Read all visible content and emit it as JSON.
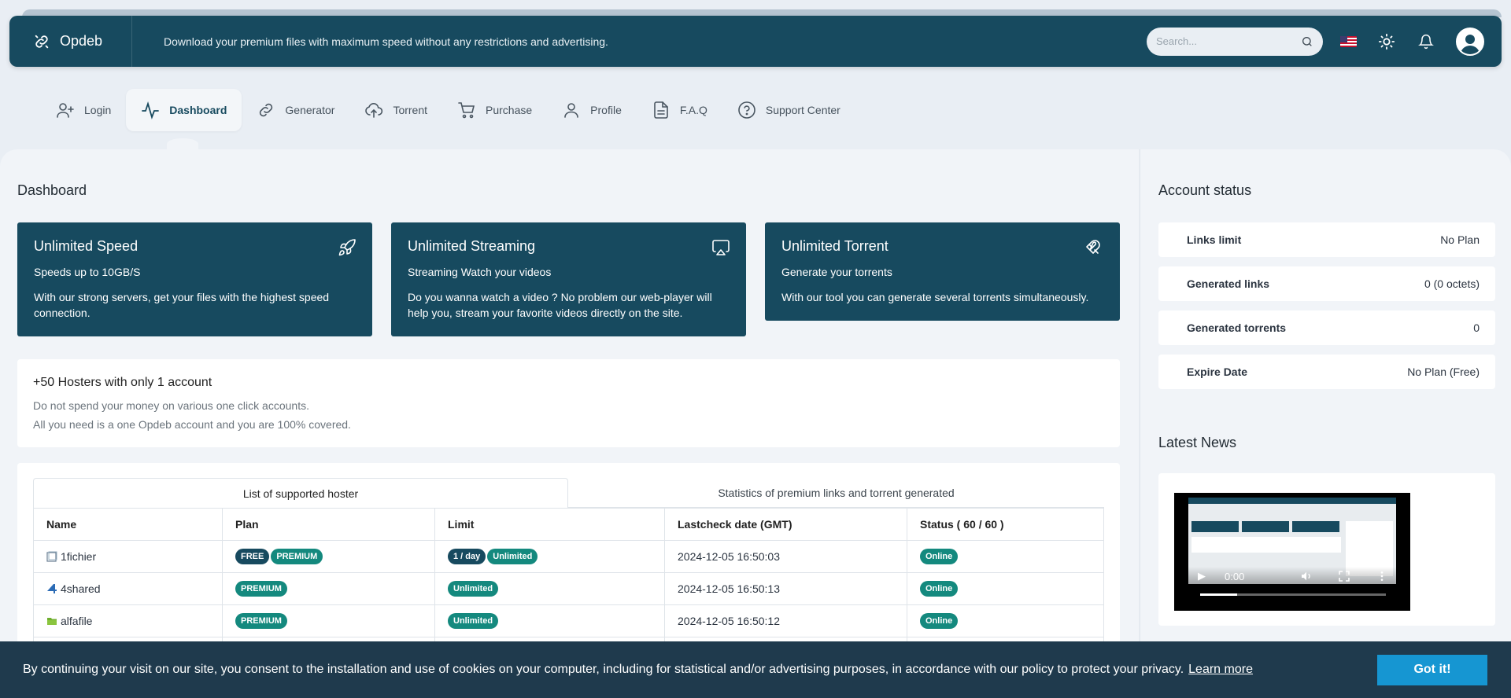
{
  "header": {
    "brand": "Opdeb",
    "tagline": "Download your premium files with maximum speed without any restrictions and advertising.",
    "search_placeholder": "Search..."
  },
  "nav": {
    "items": [
      {
        "label": "Login",
        "icon": "user-plus-icon"
      },
      {
        "label": "Dashboard",
        "icon": "activity-icon",
        "active": true
      },
      {
        "label": "Generator",
        "icon": "link-icon"
      },
      {
        "label": "Torrent",
        "icon": "cloud-upload-icon"
      },
      {
        "label": "Purchase",
        "icon": "cart-icon"
      },
      {
        "label": "Profile",
        "icon": "user-icon"
      },
      {
        "label": "F.A.Q",
        "icon": "file-icon"
      },
      {
        "label": "Support Center",
        "icon": "help-circle-icon"
      }
    ]
  },
  "dashboard": {
    "title": "Dashboard",
    "features": [
      {
        "title": "Unlimited Speed",
        "sub": "Speeds up to 10GB/S",
        "desc": "With our strong servers, get your files with the highest speed connection.",
        "icon": "rocket-icon"
      },
      {
        "title": "Unlimited Streaming",
        "sub": "Streaming Watch your videos",
        "desc": "Do you wanna watch a video ? No problem our web-player will help you, stream your favorite videos directly on the site.",
        "icon": "airplay-icon"
      },
      {
        "title": "Unlimited Torrent",
        "sub": "Generate your torrents",
        "desc": "With our tool you can generate several torrents simultaneously.",
        "icon": "magnet-icon"
      }
    ],
    "hosters": {
      "title": "+50 Hosters with only 1 account",
      "line1": "Do not spend your money on various one click accounts.",
      "line2": "All you need is a one Opdeb account and you are 100% covered."
    },
    "tabs": [
      "List of supported hoster",
      "Statistics of premium links and torrent generated"
    ],
    "table": {
      "headers": [
        "Name",
        "Plan",
        "Limit",
        "Lastcheck date (GMT)",
        "Status ( 60 / 60 )"
      ],
      "rows": [
        {
          "name": "1fichier",
          "plan": [
            "FREE",
            "PREMIUM"
          ],
          "limit": [
            "1 / day",
            "Unlimited"
          ],
          "date": "2024-12-05 16:50:03",
          "status": "Online"
        },
        {
          "name": "4shared",
          "plan": [
            "PREMIUM"
          ],
          "limit": [
            "Unlimited"
          ],
          "date": "2024-12-05 16:50:13",
          "status": "Online"
        },
        {
          "name": "alfafile",
          "plan": [
            "PREMIUM"
          ],
          "limit": [
            "Unlimited"
          ],
          "date": "2024-12-05 16:50:12",
          "status": "Online"
        }
      ]
    }
  },
  "account": {
    "title": "Account status",
    "items": [
      {
        "label": "Links limit",
        "value": "No Plan"
      },
      {
        "label": "Generated links",
        "value": "0 (0 octets)"
      },
      {
        "label": "Generated torrents",
        "value": "0"
      },
      {
        "label": "Expire Date",
        "value": "No Plan (Free)"
      }
    ]
  },
  "news": {
    "title": "Latest News",
    "video_time": "0:00",
    "video_progress": 0.2
  },
  "cookie": {
    "message": "By continuing your visit on our site, you consent to the installation and use of cookies on your computer, including for statistical and/or advertising purposes, in accordance with our policy to protect your privacy.",
    "learn_more": "Learn more",
    "accept": "Got it!"
  },
  "colors": {
    "primary": "#174a5f",
    "teal": "#14897e",
    "cookie_bg": "#1f3a4d",
    "cookie_btn": "#1696d2"
  }
}
